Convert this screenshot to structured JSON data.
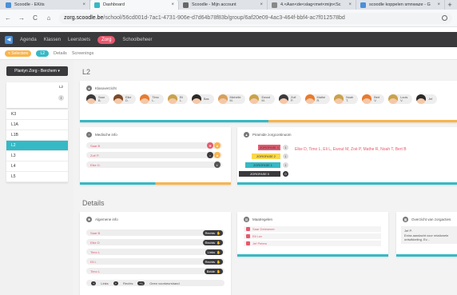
{
  "browser": {
    "tabs": [
      {
        "label": "Scoodle - EKits",
        "color": "#4a90d9",
        "active": false
      },
      {
        "label": "Dashboard",
        "color": "#35b9c5",
        "active": true
      },
      {
        "label": "Scoodle - Mijn account",
        "color": "#666666",
        "active": false
      },
      {
        "label": "4.<Aan<de<slag<met<mijn<Sc",
        "color": "#888888",
        "active": false
      },
      {
        "label": "scoodle koppelen smnwaze - G",
        "color": "#4a90d9",
        "active": false
      }
    ],
    "tab_close": "×",
    "new_tab": "+",
    "url_host": "zorg.scoodle.be",
    "url_path": "/school/56cd001d-7ac1-4731-906e-d7d64b78f83b/group/6af20e09-4ac3-464f-bbf4-ac7f012578bd",
    "nav": {
      "back": "←",
      "forward": "→",
      "reload": "C",
      "home": "⌂"
    }
  },
  "appnav": {
    "items": [
      "Agenda",
      "Klassen",
      "Leerstoets",
      "Zorg",
      "Schoolbeheer"
    ],
    "active": "Zorg"
  },
  "subnav": {
    "select": "< Selectere",
    "class": "L2",
    "details": "Details",
    "screenings": "Screenings"
  },
  "sidebar": {
    "school": "Plantyn Zorg - Berchem ▾",
    "selected": {
      "label": "L2",
      "info": "i"
    },
    "classes": [
      "K3",
      "L1A",
      "L1B",
      "L2",
      "L3",
      "L4",
      "L5"
    ],
    "active_class": "L2"
  },
  "main": {
    "class_title": "L2",
    "students_card": {
      "title": "Klasoverzicht",
      "students": [
        {
          "name": "Saar",
          "sub": "B.",
          "hair": "#3a3a3d"
        },
        {
          "name": "Elke",
          "sub": "D.",
          "hair": "#7a4a2a"
        },
        {
          "name": "Timo",
          "sub": "L.",
          "hair": "#e87a2e"
        },
        {
          "name": "Eli",
          "sub": "L.",
          "hair": "#c9a24a"
        },
        {
          "name": "Bas",
          "sub": "",
          "hair": "#2a2a2a"
        },
        {
          "name": "Michelle",
          "sub": "M.",
          "hair": "#d8a05a"
        },
        {
          "name": "Ewout",
          "sub": "M.",
          "hair": "#c9a24a"
        },
        {
          "name": "Zoë",
          "sub": "P.",
          "hair": "#3a3a3d"
        },
        {
          "name": "Mathe",
          "sub": "R.",
          "hair": "#e87a2e"
        },
        {
          "name": "Noah",
          "sub": "T.",
          "hair": "#c9a24a"
        },
        {
          "name": "Bert",
          "sub": "V.",
          "hair": "#e87a2e"
        },
        {
          "name": "Louis",
          "sub": "V.",
          "hair": "#c9a24a"
        },
        {
          "name": "Jef",
          "sub": "",
          "hair": "#2a2a2a"
        }
      ]
    },
    "medical_card": {
      "title": "Medische info",
      "rows": [
        "Saar B",
        "Zoë P.",
        "Elke D."
      ]
    },
    "pyramid_card": {
      "title": "Piramide zorgcontinuüm",
      "levels": [
        {
          "label": "ZORGFASE 3",
          "num": "1",
          "color": "#e8586e"
        },
        {
          "label": "ZORGFASE 2",
          "num": "1",
          "color": "#f9d84c"
        },
        {
          "label": "ZORGFASE 1",
          "num": "1",
          "color": "#35b9c5"
        },
        {
          "label": "ZORGFASE 0",
          "num": "0",
          "color": "#3a3a3d"
        }
      ],
      "students_line": "Elke D, Timo L, Eli L, Ewout M, Zoë P, Mathe R, Noah T, Bert B"
    },
    "details_title": "Details",
    "general_card": {
      "title": "Algemene info",
      "rows": [
        {
          "name": "Saar B",
          "badge": "Rechts"
        },
        {
          "name": "Elke D",
          "badge": "Rechts"
        },
        {
          "name": "Timo L",
          "badge": "Links"
        },
        {
          "name": "Eli L",
          "badge": "Rechts"
        },
        {
          "name": "Timo L",
          "badge": "Beide"
        }
      ],
      "legend": [
        "Links",
        "Rechts",
        "Geen voorkeurshand"
      ],
      "legend_badges": [
        "+",
        "+",
        "+/-"
      ]
    },
    "measures_card": {
      "title": "Maatregelen",
      "rows": [
        "Saar Delesener",
        "Eli Lux",
        "Jef Peters"
      ]
    },
    "overview_card": {
      "title": "Overzicht van zorgacties",
      "note_name": "Jef P.",
      "note_text": "Extra aandacht voor relationele ontwikkeling. Ev..."
    }
  },
  "colors": {
    "teal": "#35b9c5",
    "coral": "#e8586e",
    "orange": "#f9b44c",
    "dark": "#3a3a3d"
  }
}
